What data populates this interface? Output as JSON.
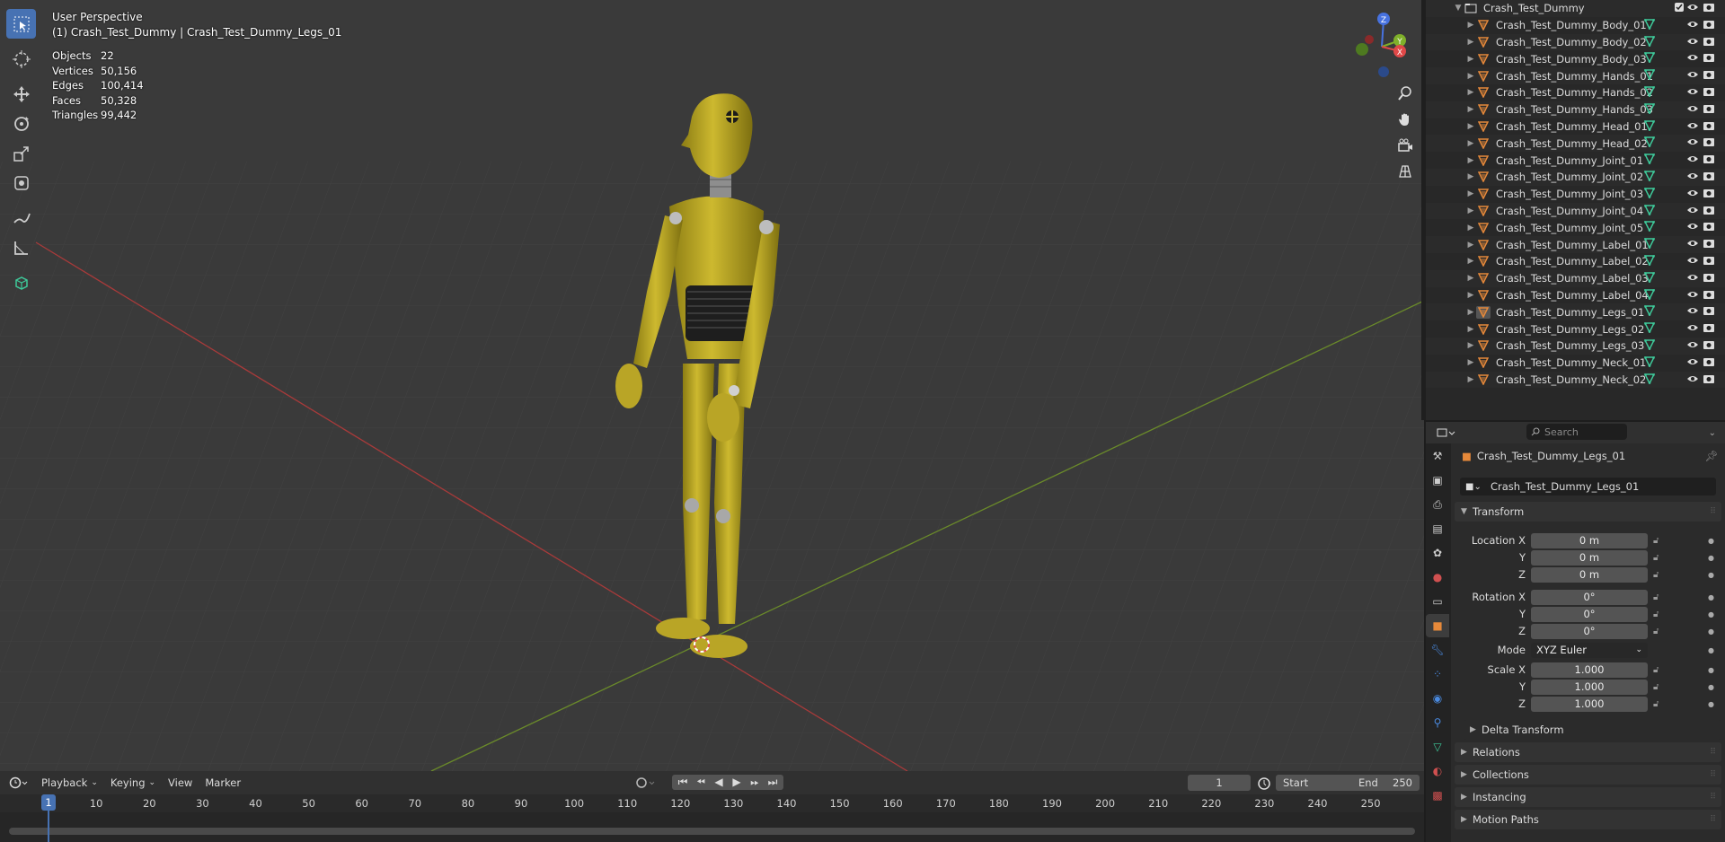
{
  "viewport": {
    "title": "User Perspective",
    "subtitle": "(1) Crash_Test_Dummy | Crash_Test_Dummy_Legs_01",
    "stats": [
      {
        "key": "Objects",
        "value": "22"
      },
      {
        "key": "Vertices",
        "value": "50,156"
      },
      {
        "key": "Edges",
        "value": "100,414"
      },
      {
        "key": "Faces",
        "value": "50,328"
      },
      {
        "key": "Triangles",
        "value": "99,442"
      }
    ],
    "gizmo": {
      "x": "X",
      "y": "Y",
      "z": "Z"
    }
  },
  "toolbar": {
    "tools": [
      "select-box-icon",
      "cursor-icon",
      "move-icon",
      "rotate-icon",
      "scale-icon",
      "transform-icon",
      "annotate-icon",
      "measure-icon",
      "add-cube-icon"
    ]
  },
  "outliner": {
    "root": "Crash_Test_Dummy",
    "items": [
      "Crash_Test_Dummy_Body_01",
      "Crash_Test_Dummy_Body_02",
      "Crash_Test_Dummy_Body_03",
      "Crash_Test_Dummy_Hands_01",
      "Crash_Test_Dummy_Hands_02",
      "Crash_Test_Dummy_Hands_03",
      "Crash_Test_Dummy_Head_01",
      "Crash_Test_Dummy_Head_02",
      "Crash_Test_Dummy_Joint_01",
      "Crash_Test_Dummy_Joint_02",
      "Crash_Test_Dummy_Joint_03",
      "Crash_Test_Dummy_Joint_04",
      "Crash_Test_Dummy_Joint_05",
      "Crash_Test_Dummy_Label_01",
      "Crash_Test_Dummy_Label_02",
      "Crash_Test_Dummy_Label_03",
      "Crash_Test_Dummy_Label_04",
      "Crash_Test_Dummy_Legs_01",
      "Crash_Test_Dummy_Legs_02",
      "Crash_Test_Dummy_Legs_03",
      "Crash_Test_Dummy_Neck_01",
      "Crash_Test_Dummy_Neck_02"
    ],
    "active_item": "Crash_Test_Dummy_Legs_01"
  },
  "properties": {
    "search_placeholder": "Search",
    "object_name": "Crash_Test_Dummy_Legs_01",
    "object_field": "Crash_Test_Dummy_Legs_01",
    "transform": {
      "title": "Transform",
      "location_label": "Location X",
      "rotation_label": "Rotation X",
      "scale_label": "Scale X",
      "y_label": "Y",
      "z_label": "Z",
      "location": [
        "0 m",
        "0 m",
        "0 m"
      ],
      "rotation": [
        "0°",
        "0°",
        "0°"
      ],
      "mode_label": "Mode",
      "mode_value": "XYZ Euler",
      "scale": [
        "1.000",
        "1.000",
        "1.000"
      ]
    },
    "delta_transform": "Delta Transform",
    "panels": [
      "Relations",
      "Collections",
      "Instancing",
      "Motion Paths"
    ]
  },
  "timeline": {
    "menus": [
      "Playback",
      "Keying",
      "View",
      "Marker"
    ],
    "current_frame": "1",
    "start_label": "Start",
    "start_value": "1",
    "end_label": "End",
    "end_value": "250",
    "playhead": "1",
    "ticks": [
      "10",
      "20",
      "30",
      "40",
      "50",
      "60",
      "70",
      "80",
      "90",
      "100",
      "110",
      "120",
      "130",
      "140",
      "150",
      "160",
      "170",
      "180",
      "190",
      "200",
      "210",
      "220",
      "230",
      "240",
      "250"
    ]
  },
  "colors": {
    "accent": "#4772b3",
    "object_orange": "#e6893a",
    "mesh_green": "#3ec99a",
    "dummy_yellow": "#c9b52e"
  }
}
